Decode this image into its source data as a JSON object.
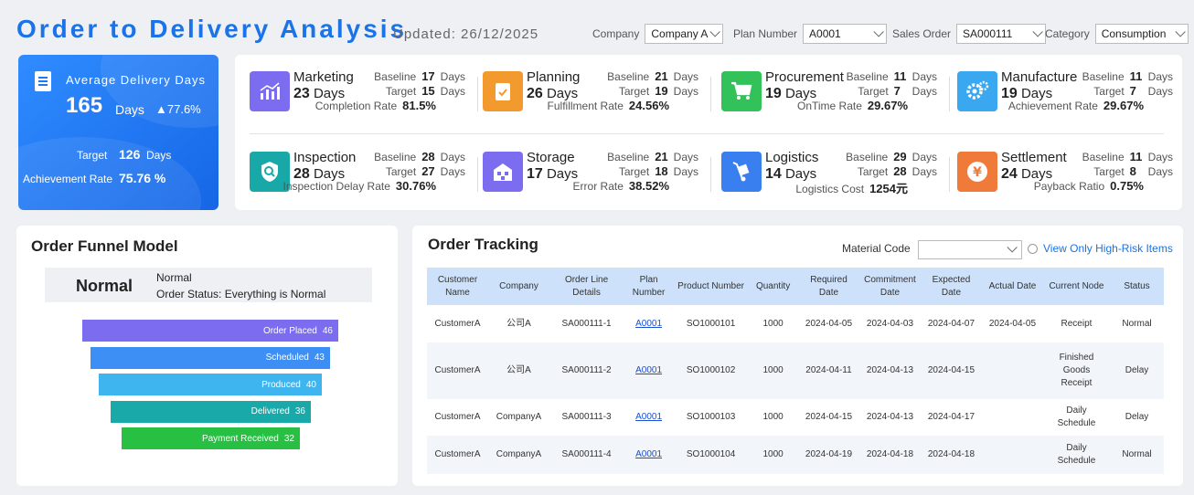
{
  "header": {
    "title": "Order to Delivery Analysis",
    "updated": "Updated: 26/12/2025",
    "filters": [
      {
        "label": "Company",
        "value": "Company A"
      },
      {
        "label": "Plan Number",
        "value": "A0001"
      },
      {
        "label": "Sales Order",
        "value": "SA000111"
      },
      {
        "label": "Category",
        "value": "Consumption"
      }
    ]
  },
  "summary": {
    "label": "Average Delivery Days",
    "value": "165",
    "unit": "Days",
    "trend": "▲77.6%",
    "target_label": "Target",
    "target_value": "126",
    "target_unit": "Days",
    "achievement_label": "Achievement Rate",
    "achievement_value": "75.76 %"
  },
  "kpis": [
    {
      "name": "Marketing",
      "days": "23",
      "unit": "Days",
      "baseline": "17",
      "target": "15",
      "metric_label": "Completion Rate",
      "metric_value": "81.5%",
      "icon": "chart-bars-icon",
      "color": "#7b6cf0"
    },
    {
      "name": "Planning",
      "days": "26",
      "unit": "Days",
      "baseline": "21",
      "target": "19",
      "metric_label": "Fulfillment Rate",
      "metric_value": "24.56%",
      "icon": "clipboard-check-icon",
      "color": "#f29a2e"
    },
    {
      "name": "Procurement",
      "days": "19",
      "unit": "Days",
      "baseline": "11",
      "target": "7",
      "metric_label": "OnTime Rate",
      "metric_value": "29.67%",
      "icon": "cart-icon",
      "color": "#33c159"
    },
    {
      "name": "Manufacture",
      "days": "19",
      "unit": "Days",
      "baseline": "11",
      "target": "7",
      "metric_label": "Achievement Rate",
      "metric_value": "29.67%",
      "icon": "gears-icon",
      "color": "#3aa8f0"
    },
    {
      "name": "Inspection",
      "days": "28",
      "unit": "Days",
      "baseline": "28",
      "target": "27",
      "metric_label": "Inspection Delay Rate",
      "metric_value": "30.76%",
      "icon": "shield-search-icon",
      "color": "#19a8a8"
    },
    {
      "name": "Storage",
      "days": "17",
      "unit": "Days",
      "baseline": "21",
      "target": "18",
      "metric_label": "Error Rate",
      "metric_value": "38.52%",
      "icon": "warehouse-icon",
      "color": "#7b6cf0"
    },
    {
      "name": "Logistics",
      "days": "14",
      "unit": "Days",
      "baseline": "29",
      "target": "28",
      "metric_label": "Logistics Cost",
      "metric_value": "1254元",
      "icon": "hand-truck-icon",
      "color": "#3a7ff0"
    },
    {
      "name": "Settlement",
      "days": "24",
      "unit": "Days",
      "baseline": "11",
      "target": "8",
      "metric_label": "Payback Ratio",
      "metric_value": "0.75%",
      "icon": "yen-coin-icon",
      "color": "#f07a3a"
    }
  ],
  "kpi_labels": {
    "baseline": "Baseline",
    "target": "Target",
    "days": "Days"
  },
  "funnel": {
    "title": "Order Funnel Model",
    "status_big": "Normal",
    "status_line1": "Normal",
    "status_line2": "Order Status: Everything is Normal",
    "stages": [
      {
        "label": "Order Placed",
        "value": "46",
        "color": "#7b6cf0"
      },
      {
        "label": "Scheduled",
        "value": "43",
        "color": "#3d8ef5"
      },
      {
        "label": "Produced",
        "value": "40",
        "color": "#3eb5ef"
      },
      {
        "label": "Delivered",
        "value": "36",
        "color": "#1aa9a9"
      },
      {
        "label": "Payment Received",
        "value": "32",
        "color": "#27c043"
      }
    ]
  },
  "tracking": {
    "title": "Order Tracking",
    "material_label": "Material Code",
    "material_value": "",
    "high_risk_label": "View Only High-Risk Items",
    "columns": [
      "Customer Name",
      "Company",
      "Order Line Details",
      "Plan Number",
      "Product Number",
      "Quantity",
      "Required Date",
      "Commitment Date",
      "Expected Date",
      "Actual Date",
      "Current Node",
      "Status"
    ],
    "rows": [
      [
        "CustomerA",
        "公司A",
        "SA000111-1",
        "A0001",
        "SO1000101",
        "1000",
        "2024-04-05",
        "2024-04-03",
        "2024-04-07",
        "2024-04-05",
        "Receipt",
        "Normal"
      ],
      [
        "CustomerA",
        "公司A",
        "SA000111-2",
        "A0001",
        "SO1000102",
        "1000",
        "2024-04-11",
        "2024-04-13",
        "2024-04-15",
        "",
        "Finished Goods Receipt",
        "Delay"
      ],
      [
        "CustomerA",
        "CompanyA",
        "SA000111-3",
        "A0001",
        "SO1000103",
        "1000",
        "2024-04-15",
        "2024-04-13",
        "2024-04-17",
        "",
        "Daily Schedule",
        "Delay"
      ],
      [
        "CustomerA",
        "CompanyA",
        "SA000111-4",
        "A0001",
        "SO1000104",
        "1000",
        "2024-04-19",
        "2024-04-18",
        "2024-04-18",
        "",
        "Daily Schedule",
        "Normal"
      ]
    ]
  }
}
